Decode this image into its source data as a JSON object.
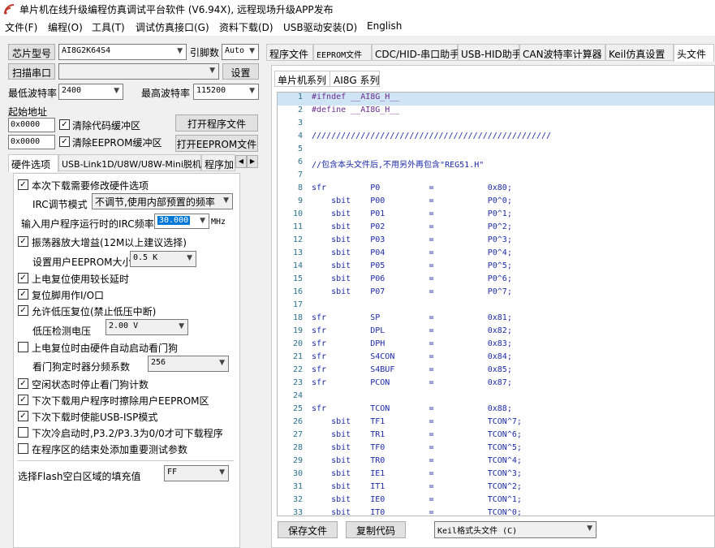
{
  "window": {
    "title": "单片机在线升级编程仿真调试平台软件 (V6.94X), 远程现场升级APP发布"
  },
  "menu": [
    "文件(F)",
    "编程(O)",
    "工具(T)",
    "调试仿真接口(G)",
    "资料下载(D)",
    "USB驱动安装(D)",
    "English"
  ],
  "left": {
    "chip_label": "芯片型号",
    "chip_value": "AI8G2K64S4",
    "pin_label": "引脚数",
    "pin_value": "Auto",
    "scan_label": "扫描串口",
    "port_value": "",
    "settings_label": "设置",
    "min_baud_label": "最低波特率",
    "min_baud": "2400",
    "max_baud_label": "最高波特率",
    "max_baud": "115200",
    "start_addr_label": "起始地址",
    "addr1": "0x0000",
    "clear_code": "清除代码缓冲区",
    "open_prog": "打开程序文件",
    "addr2": "0x0000",
    "clear_eeprom": "清除EEPROM缓冲区",
    "open_eeprom": "打开EEPROM文件",
    "tabs": [
      "硬件选项",
      "USB-Link1D/U8W/U8W-Mini脱机",
      "程序加"
    ],
    "hw": {
      "opt_modify": "本次下载需要修改硬件选项",
      "irc_mode_label": "IRC调节模式",
      "irc_mode_value": "不调节,使用内部预置的频率",
      "irc_freq_label": "输入用户程序运行时的IRC频率",
      "irc_freq_value": "30.000",
      "irc_unit": "MHz",
      "opt_osc": "振荡器放大增益(12M以上建议选择)",
      "eeprom_size_label": "设置用户EEPROM大小",
      "eeprom_size_value": "0.5 K",
      "opt_long_reset": "上电复位使用较长延时",
      "opt_reset_io": "复位脚用作I/O口",
      "opt_lvr": "允许低压复位(禁止低压中断)",
      "lvd_label": "低压检测电压",
      "lvd_value": "2.00 V",
      "opt_wdt_hw": "上电复位时由硬件自动启动看门狗",
      "wdt_div_label": "看门狗定时器分频系数",
      "wdt_div_value": "256",
      "opt_wdt_idle": "空闲状态时停止看门狗计数",
      "opt_erase_eeprom": "下次下载用户程序时擦除用户EEPROM区",
      "opt_usb_isp": "下次下载时使能USB-ISP模式",
      "opt_cold": "下次冷启动时,P3.2/P3.3为0/0才可下载程序",
      "opt_test_param": "在程序区的结束处添加重要测试参数",
      "flash_fill_label": "选择Flash空白区域的填充值",
      "flash_fill_value": "FF"
    }
  },
  "right": {
    "tabs": [
      "程序文件",
      "EEPROM文件",
      "CDC/HID-串口助手",
      "USB-HID助手",
      "CAN波特率计算器",
      "Keil仿真设置",
      "头文件"
    ],
    "series_label": "单片机系列",
    "series_value": "AI8G 系列",
    "save_label": "保存文件",
    "copy_label": "复制代码",
    "format_value": "Keil格式头文件 (C)",
    "lines": [
      [
        "1",
        "#ifndef __AI8G_H__"
      ],
      [
        "2",
        "#define __AI8G_H__"
      ],
      [
        "3",
        ""
      ],
      [
        "4",
        "/////////////////////////////////////////////////"
      ],
      [
        "5",
        ""
      ],
      [
        "6",
        "//包含本头文件后,不用另外再包含\"REG51.H\""
      ],
      [
        "7",
        ""
      ],
      [
        "8",
        "sfr         P0          =           0x80;"
      ],
      [
        "9",
        "    sbit    P00         =           P0^0;"
      ],
      [
        "10",
        "    sbit    P01         =           P0^1;"
      ],
      [
        "11",
        "    sbit    P02         =           P0^2;"
      ],
      [
        "12",
        "    sbit    P03         =           P0^3;"
      ],
      [
        "13",
        "    sbit    P04         =           P0^4;"
      ],
      [
        "14",
        "    sbit    P05         =           P0^5;"
      ],
      [
        "15",
        "    sbit    P06         =           P0^6;"
      ],
      [
        "16",
        "    sbit    P07         =           P0^7;"
      ],
      [
        "17",
        ""
      ],
      [
        "18",
        "sfr         SP          =           0x81;"
      ],
      [
        "19",
        "sfr         DPL         =           0x82;"
      ],
      [
        "20",
        "sfr         DPH         =           0x83;"
      ],
      [
        "21",
        "sfr         S4CON       =           0x84;"
      ],
      [
        "22",
        "sfr         S4BUF       =           0x85;"
      ],
      [
        "23",
        "sfr         PCON        =           0x87;"
      ],
      [
        "24",
        ""
      ],
      [
        "25",
        "sfr         TCON        =           0x88;"
      ],
      [
        "26",
        "    sbit    TF1         =           TCON^7;"
      ],
      [
        "27",
        "    sbit    TR1         =           TCON^6;"
      ],
      [
        "28",
        "    sbit    TF0         =           TCON^5;"
      ],
      [
        "29",
        "    sbit    TR0         =           TCON^4;"
      ],
      [
        "30",
        "    sbit    IE1         =           TCON^3;"
      ],
      [
        "31",
        "    sbit    IT1         =           TCON^2;"
      ],
      [
        "32",
        "    sbit    IE0         =           TCON^1;"
      ],
      [
        "33",
        "    sbit    IT0         =           TCON^0;"
      ]
    ]
  }
}
